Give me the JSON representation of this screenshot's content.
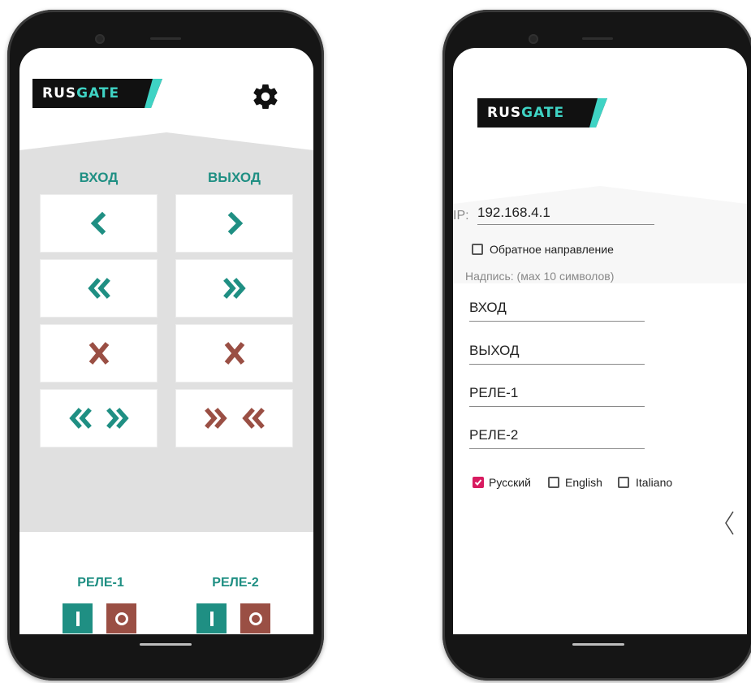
{
  "app": {
    "logo": {
      "part1": "RUS",
      "part2": "GATE"
    },
    "headers": {
      "in": "ВХОД",
      "out": "ВЫХОД"
    },
    "buttons": [
      {
        "id": "in-single",
        "icon": "chevron-left-icon"
      },
      {
        "id": "out-single",
        "icon": "chevron-right-icon"
      },
      {
        "id": "in-double",
        "icon": "double-chevron-left-icon"
      },
      {
        "id": "out-double",
        "icon": "double-chevron-right-icon"
      },
      {
        "id": "in-close",
        "icon": "close-icon"
      },
      {
        "id": "out-close",
        "icon": "close-icon"
      },
      {
        "id": "open-both",
        "icon": "chevrons-outward-icon"
      },
      {
        "id": "close-both",
        "icon": "chevrons-inward-icon"
      }
    ],
    "relays": [
      {
        "label": "РЕЛЕ-1",
        "on": "I",
        "off": "O"
      },
      {
        "label": "РЕЛЕ-2",
        "on": "I",
        "off": "O"
      }
    ],
    "settings_icon": "gear-icon"
  },
  "settings": {
    "ip_label": "IP:",
    "ip_value": "192.168.4.1",
    "reverse_label": "Обратное направление",
    "reverse_checked": false,
    "caption_hint": "Надпись: (мах 10 символов)",
    "captions": [
      "ВХОД",
      "ВЫХОД",
      "РЕЛЕ-1",
      "РЕЛЕ-2"
    ],
    "languages": [
      {
        "label": "Русский",
        "checked": true
      },
      {
        "label": "English",
        "checked": false
      },
      {
        "label": "Italiano",
        "checked": false
      }
    ],
    "back_icon": "chevron-left-icon"
  },
  "colors": {
    "teal": "#1f8f83",
    "red": "#9a4f44",
    "grey": "#e0e0e0",
    "accent": "#d81b60"
  }
}
